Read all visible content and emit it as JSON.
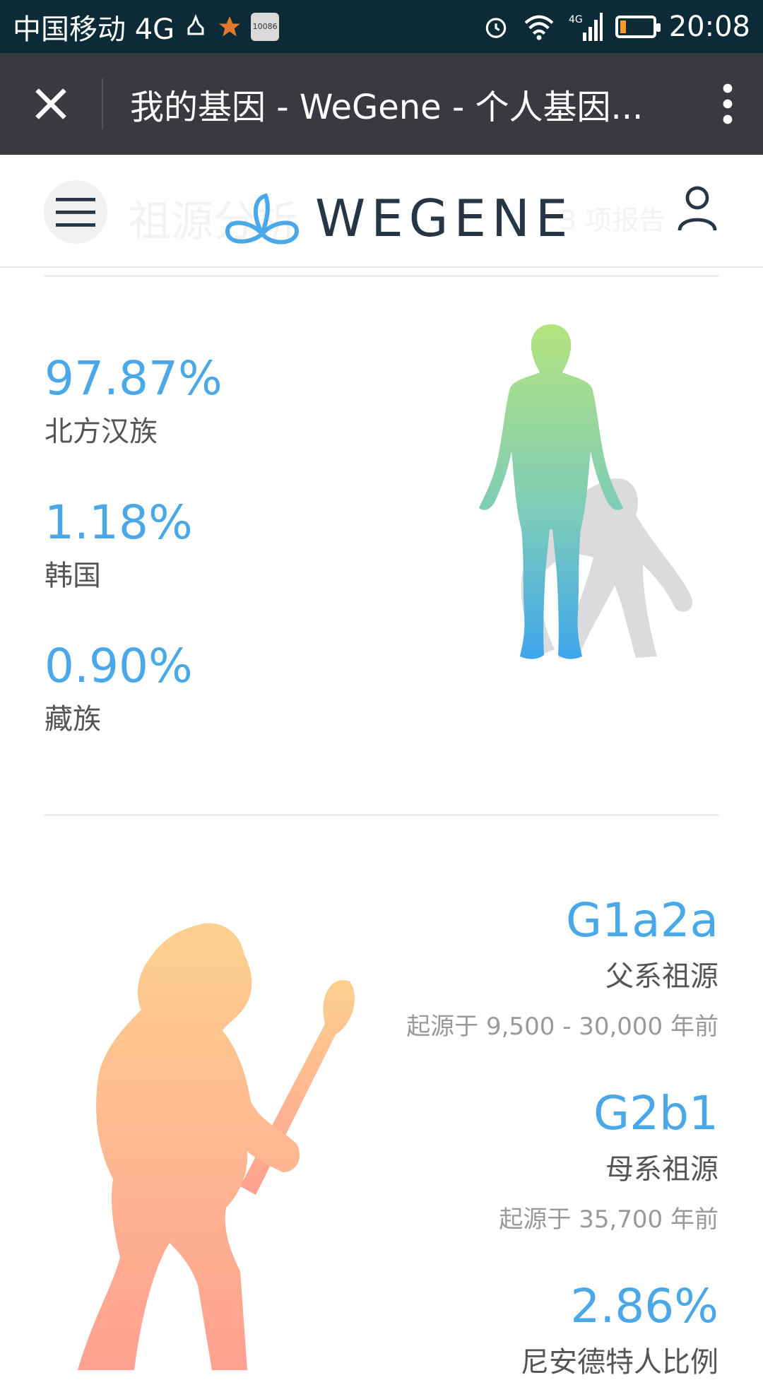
{
  "status_bar": {
    "carrier": "中国移动 4G",
    "badge": "10086",
    "network": "4G",
    "time": "20:08"
  },
  "browser": {
    "title": "我的基因 - WeGene - 个人基因..."
  },
  "nav": {
    "ghost_left": "祖源分析",
    "ghost_right": "3 项报告",
    "logo_text": "WEGENE"
  },
  "ancestry": [
    {
      "percent": "97.87%",
      "name": "北方汉族"
    },
    {
      "percent": "1.18%",
      "name": "韩国"
    },
    {
      "percent": "0.90%",
      "name": "藏族"
    }
  ],
  "haplogroups": {
    "paternal": {
      "code": "G1a2a",
      "label": "父系祖源",
      "origin": "起源于 9,500 - 30,000 年前"
    },
    "maternal": {
      "code": "G2b1",
      "label": "母系祖源",
      "origin": "起源于 35,700 年前"
    },
    "neanderthal": {
      "percent": "2.86%",
      "label": "尼安德特人比例"
    }
  },
  "colors": {
    "accent": "#4aa8e8",
    "status_bg": "#0c2b36",
    "browser_bg": "#393a3f"
  }
}
